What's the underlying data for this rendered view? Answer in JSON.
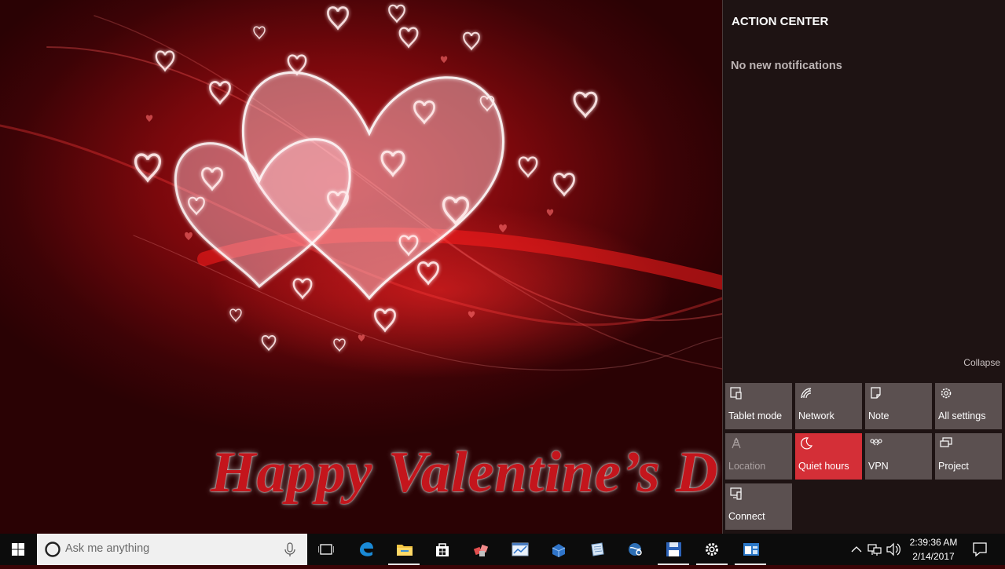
{
  "wallpaper": {
    "greeting": "Happy Valentine’s D"
  },
  "action_center": {
    "title": "ACTION CENTER",
    "empty_message": "No new notifications",
    "collapse_label": "Collapse",
    "tiles": [
      {
        "label": "Tablet mode",
        "icon": "tablet-mode-icon",
        "state": "off"
      },
      {
        "label": "Network",
        "icon": "network-icon",
        "state": "off"
      },
      {
        "label": "Note",
        "icon": "note-icon",
        "state": "off"
      },
      {
        "label": "All settings",
        "icon": "gear-icon",
        "state": "off"
      },
      {
        "label": "Location",
        "icon": "location-icon",
        "state": "disabled"
      },
      {
        "label": "Quiet hours",
        "icon": "moon-icon",
        "state": "on"
      },
      {
        "label": "VPN",
        "icon": "vpn-icon",
        "state": "off"
      },
      {
        "label": "Project",
        "icon": "project-icon",
        "state": "off"
      },
      {
        "label": "Connect",
        "icon": "connect-icon",
        "state": "off"
      }
    ],
    "accent_color": "#d42f37"
  },
  "taskbar": {
    "search_placeholder": "Ask me anything",
    "pinned_apps": [
      {
        "name": "task-view",
        "icon": "task-view-icon",
        "open": false
      },
      {
        "name": "edge",
        "icon": "edge-icon",
        "open": false
      },
      {
        "name": "file-explorer",
        "icon": "folder-icon",
        "open": true
      },
      {
        "name": "store",
        "icon": "store-icon",
        "open": false
      },
      {
        "name": "app-cubes",
        "icon": "cubes-icon",
        "open": false
      },
      {
        "name": "app-graph",
        "icon": "graph-window-icon",
        "open": false
      },
      {
        "name": "app-tools",
        "icon": "toolbox-icon",
        "open": false
      },
      {
        "name": "app-notes",
        "icon": "notepad-icon",
        "open": false
      },
      {
        "name": "app-globe",
        "icon": "globe-search-icon",
        "open": false
      },
      {
        "name": "app-disk",
        "icon": "floppy-disk-icon",
        "open": true
      },
      {
        "name": "settings",
        "icon": "gear-icon",
        "open": true
      },
      {
        "name": "app-window",
        "icon": "window-app-icon",
        "open": true
      }
    ],
    "clock": {
      "time": "2:39:36 AM",
      "date": "2/14/2017"
    }
  }
}
